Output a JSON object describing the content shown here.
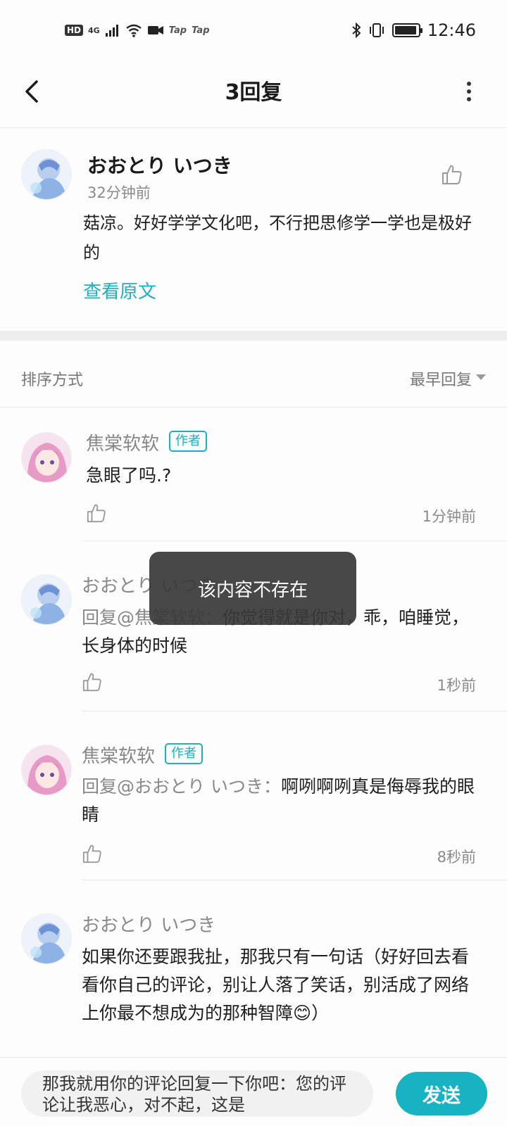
{
  "status_bar": {
    "hd": "HD",
    "network": "4G",
    "tap1": "Tap",
    "tap2": "Tap",
    "time": "12:46"
  },
  "nav": {
    "title": "3回复"
  },
  "original_comment": {
    "author": "おおとり いつき",
    "time": "32分钟前",
    "text": "菇凉。好好学学文化吧，不行把思修学一学也是极好的",
    "view_original": "查看原文"
  },
  "sort": {
    "label": "排序方式",
    "value": "最早回复"
  },
  "replies": [
    {
      "author": "焦棠软软",
      "tag": "作者",
      "mention": "",
      "text": "急眼了吗.?",
      "time": "1分钟前"
    },
    {
      "author": "おおとり いつき",
      "tag": "",
      "mention": "回复@焦棠软软：",
      "text": "你觉得就是你对，乖，咱睡觉，长身体的时候",
      "time": "1秒前"
    },
    {
      "author": "焦棠软软",
      "tag": "作者",
      "mention": "回复@おおとり いつき：",
      "text": "啊咧啊咧真是侮辱我的眼睛",
      "time": "8秒前"
    },
    {
      "author": "おおとり いつき",
      "tag": "",
      "mention": "",
      "text": "如果你还要跟我扯，那我只有一句话（好好回去看看你自己的评论，别让人落了笑话，别活成了网络上你最不想成为的那种智障😊）",
      "time": ""
    }
  ],
  "toast": "该内容不存在",
  "composer": {
    "value": "那我就用你的评论回复一下你吧：您的评论让我恶心，对不起，这是",
    "send_label": "发送"
  },
  "colors": {
    "accent": "#17b3c2",
    "muted_text": "#888888",
    "divider": "#ececec"
  },
  "icons": {
    "back": "chevron-left-icon",
    "more": "more-vertical-icon",
    "like": "thumbs-up-icon",
    "avatar_a": "anime-boy-avatar",
    "avatar_b": "anime-girl-pink-avatar"
  }
}
